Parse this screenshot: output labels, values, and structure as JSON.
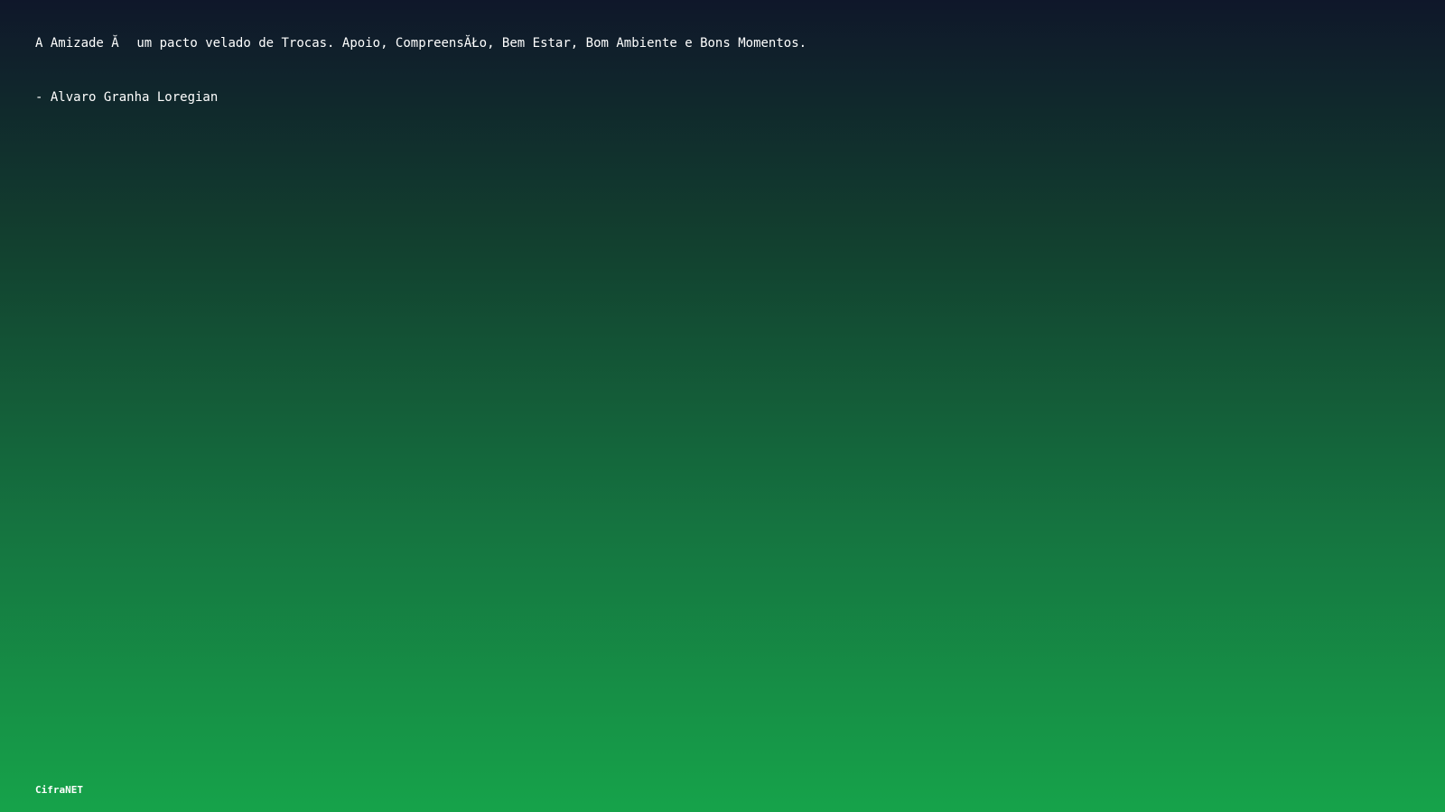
{
  "quote": {
    "text": "A Amizade Ă um pacto velado de Trocas. Apoio, CompreensĂŁo, Bem Estar, Bom Ambiente e Bons Momentos.",
    "author": "- Alvaro Granha Loregian"
  },
  "footer": {
    "brand": "CifraNET"
  },
  "colors": {
    "background_top": "#0f172a",
    "background_bottom": "#16a34a",
    "text": "#ffffff"
  }
}
